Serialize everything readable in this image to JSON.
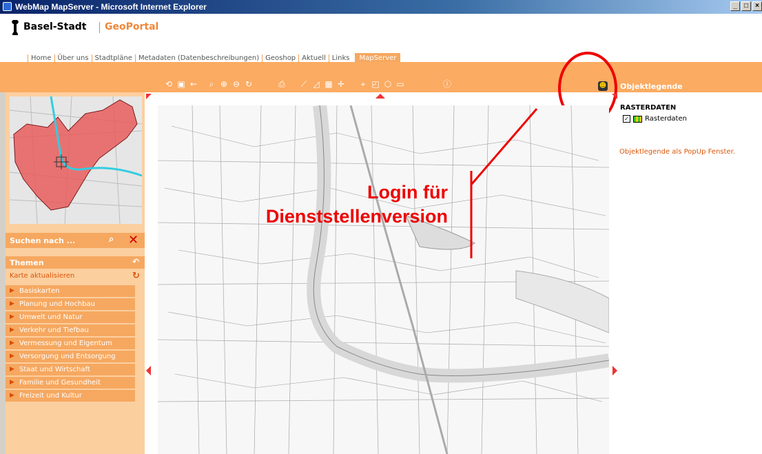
{
  "window": {
    "title": "WebMap MapServer - Microsoft Internet Explorer"
  },
  "brand": {
    "name": "Basel-Stadt",
    "portal": "GeoPortal"
  },
  "nav": {
    "tabs": [
      "Home",
      "Über uns",
      "Stadtpläne",
      "Metadaten (Datenbeschreibungen)",
      "Geoshop",
      "Aktuell",
      "Links"
    ],
    "active": "MapServer"
  },
  "toolbar": {
    "icons": [
      "refresh-icon",
      "fullextent-icon",
      "back-icon",
      "zoom-pan-icon",
      "zoom-in-icon",
      "zoom-out-icon",
      "reload-icon",
      "print-icon",
      "measure-distance-icon",
      "measure-area-icon",
      "measure-grid-icon",
      "coordinates-icon",
      "identify-icon",
      "select-area-icon",
      "select-poly-icon",
      "select-box-icon",
      "info-icon"
    ]
  },
  "legend_header": {
    "label": "Objektlegende"
  },
  "left": {
    "search_label": "Suchen nach ...",
    "themes_label": "Themen",
    "refresh_label": "Karte aktualisieren",
    "themes": [
      "Basiskarten",
      "Planung und Hochbau",
      "Umwelt und Natur",
      "Verkehr und Tiefbau",
      "Vermessung und Eigentum",
      "Versorgung und Entsorgung",
      "Staat und Wirtschaft",
      "Familie und Gesundheit",
      "Freizeit und Kultur"
    ]
  },
  "annotation": {
    "line1": "Login für",
    "line2": "Dienststellenversion"
  },
  "legend": {
    "section": "RASTERDATEN",
    "item": "Rasterdaten",
    "popup_link": "Objektlegende als PopUp Fenster."
  },
  "colors": {
    "accent": "#fbab62",
    "annotation": "#e00000"
  }
}
